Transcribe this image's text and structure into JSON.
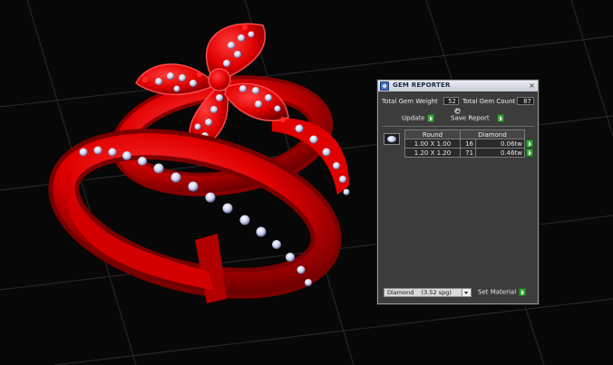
{
  "viewport": {
    "description_icon": "3d-jewelry-render"
  },
  "panel": {
    "title": "GEM REPORTER",
    "close_glyph": "×",
    "total_weight_label": "Total Gem Weight",
    "total_weight_value": "52",
    "total_count_label": "Total Gem Count",
    "total_count_value": "87",
    "update_label": "Update",
    "save_report_label": "Save Report",
    "table": {
      "headers": [
        "Round",
        "Diamond"
      ],
      "rows": [
        {
          "size": "1.00 X 1.00",
          "count": "16",
          "weight": "0.06tw"
        },
        {
          "size": "1.20 X 1.20",
          "count": "71",
          "weight": "0.46tw"
        }
      ]
    },
    "material_value": "Diamond    (3.52 spg)",
    "set_material_label": "Set Material"
  },
  "colors": {
    "ring_red": "#ff0a0a",
    "panel_bg": "#3c3c3c",
    "go_green": "#39a23b"
  }
}
